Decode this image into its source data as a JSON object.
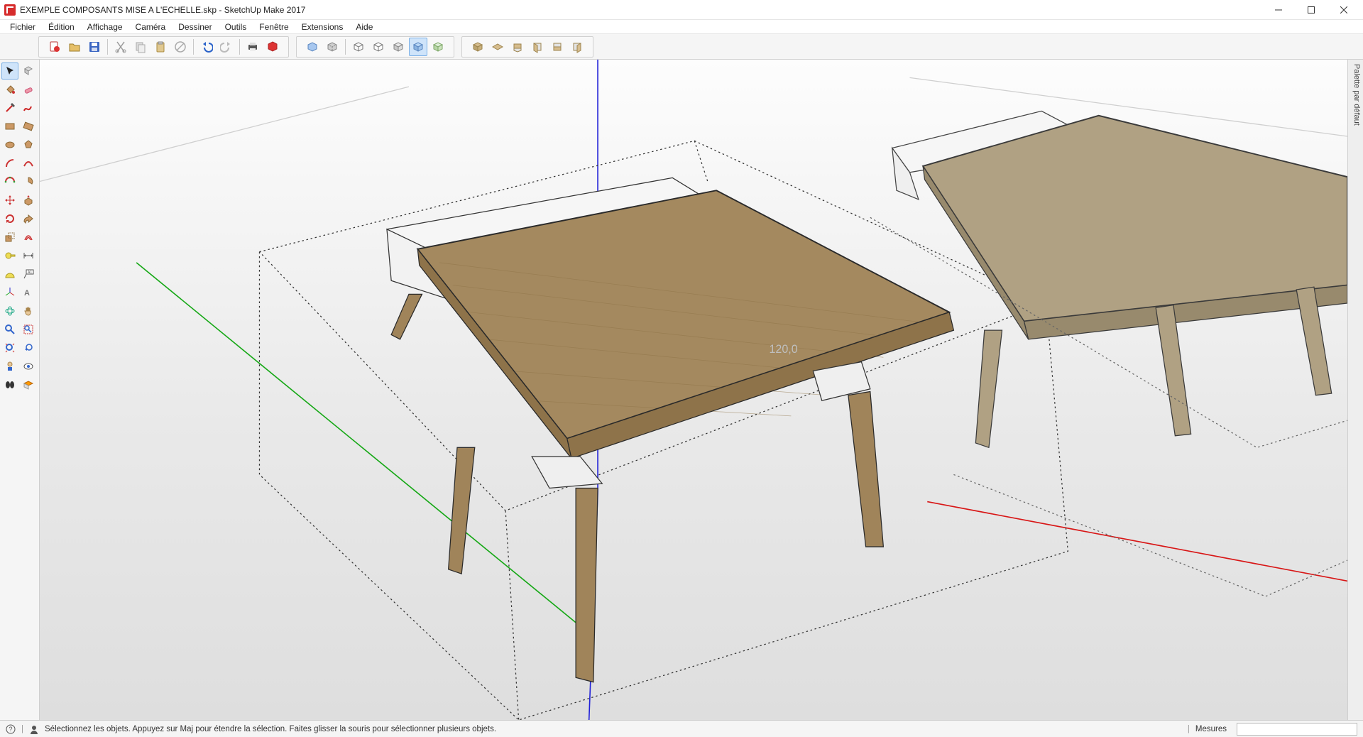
{
  "window": {
    "title": "EXEMPLE COMPOSANTS MISE A L'ECHELLE.skp - SketchUp Make 2017"
  },
  "menubar": {
    "items": [
      "Fichier",
      "Édition",
      "Affichage",
      "Caméra",
      "Dessiner",
      "Outils",
      "Fenêtre",
      "Extensions",
      "Aide"
    ]
  },
  "toolbar_top": {
    "groups": [
      {
        "name": "file-edit",
        "icons": [
          "new-from-template-icon",
          "open-icon",
          "save-icon",
          "sep",
          "cut-icon",
          "copy-icon",
          "paste-icon",
          "delete-icon",
          "sep",
          "undo-icon",
          "redo-icon",
          "sep",
          "print-icon",
          "model-info-icon"
        ]
      },
      {
        "name": "styles",
        "icons": [
          "xray-icon",
          "back-edges-icon",
          "sep",
          "wireframe-icon",
          "hidden-line-icon",
          "shaded-icon",
          "shaded-textures-icon",
          "monochrome-icon"
        ]
      },
      {
        "name": "views",
        "icons": [
          "iso-icon",
          "top-icon",
          "front-icon",
          "right-icon",
          "back-icon",
          "left-icon"
        ]
      }
    ]
  },
  "left_tools": {
    "rows": [
      [
        "select-tool-icon",
        "make-component-icon"
      ],
      [
        "paint-bucket-icon",
        "eraser-icon"
      ],
      [
        "line-icon",
        "freehand-icon"
      ],
      [
        "rectangle-icon",
        "rotated-rectangle-icon"
      ],
      [
        "circle-icon",
        "polygon-icon"
      ],
      [
        "arc-icon",
        "two-point-arc-icon"
      ],
      [
        "three-point-arc-icon",
        "pie-icon"
      ],
      [
        "move-icon",
        "pushpull-icon"
      ],
      [
        "rotate-icon",
        "followme-icon"
      ],
      [
        "scale-icon",
        "offset-icon"
      ],
      [
        "tape-measure-icon",
        "dimension-icon"
      ],
      [
        "protractor-icon",
        "text-label-icon"
      ],
      [
        "axes-icon",
        "three-d-text-icon"
      ],
      [
        "orbit-icon",
        "pan-icon"
      ],
      [
        "zoom-icon",
        "zoom-window-icon"
      ],
      [
        "zoom-extents-icon",
        "previous-view-icon"
      ],
      [
        "position-camera-icon",
        "look-around-icon"
      ],
      [
        "walk-icon",
        "section-plane-icon"
      ]
    ]
  },
  "right_tray": {
    "label": "Palette par défaut"
  },
  "statusbar": {
    "hint": "Sélectionnez les objets. Appuyez sur Maj pour étendre la sélection. Faites glisser la souris pour sélectionner plusieurs objets.",
    "measure_label": "Mesures"
  },
  "viewport": {
    "dimension_label": "120,0"
  }
}
